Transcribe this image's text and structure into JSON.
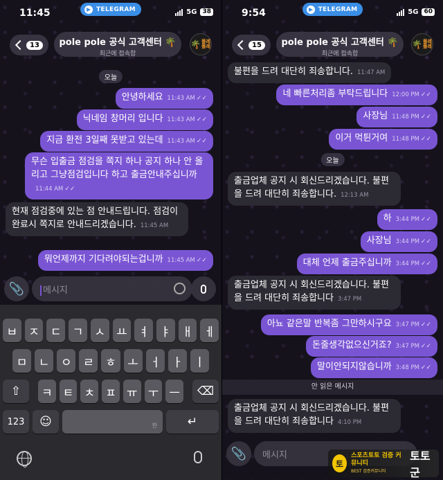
{
  "left": {
    "status": {
      "time": "11:45",
      "app": "TELEGRAM",
      "network": "5G",
      "battery": "38"
    },
    "header": {
      "unread": "13",
      "title": "pole pole 공식 고객센터 🌴",
      "subtitle": "최근에 접속함",
      "avatar_text": "폴레폴레"
    },
    "date_separator": "오늘",
    "messages": [
      {
        "dir": "out",
        "text": "안녕하세요",
        "time": "11:43 AM"
      },
      {
        "dir": "out",
        "text": "닉네임 창머리 입니다",
        "time": "11:43 AM"
      },
      {
        "dir": "out",
        "text": "지금 환전 3일째 못받고 있는데",
        "time": "11:43 AM"
      },
      {
        "dir": "out",
        "text": "무슨 입출금 점검을 쪽지 하나 공지 하나 안 올리고  그냥점검입니다 하고 출금안내주십니까",
        "time": "11:44 AM"
      },
      {
        "dir": "in",
        "text": "현재 점검중에 있는 점 안내드립니다. 점검이 완료시 쪽지로 안내드리겠습니다.",
        "time": "11:45 AM"
      },
      {
        "dir": "out",
        "text": "뭐언제까지 기다려야되는겁니까",
        "time": "11:45 AM"
      }
    ],
    "input_placeholder": "메시지",
    "keyboard": {
      "row1": [
        "ㅂ",
        "ㅈ",
        "ㄷ",
        "ㄱ",
        "ㅅ",
        "ㅛ",
        "ㅕ",
        "ㅑ",
        "ㅐ",
        "ㅔ"
      ],
      "row2": [
        "ㅁ",
        "ㄴ",
        "ㅇ",
        "ㄹ",
        "ㅎ",
        "ㅗ",
        "ㅓ",
        "ㅏ",
        "ㅣ"
      ],
      "row3": [
        "ㅋ",
        "ㅌ",
        "ㅊ",
        "ㅍ",
        "ㅠ",
        "ㅜ",
        "ㅡ"
      ],
      "num_key": "123",
      "space_label": "한",
      "shift_glyph": "⇧",
      "delete_glyph": "⌫",
      "return_glyph": "↵",
      "emoji_glyph": "☺"
    }
  },
  "right": {
    "status": {
      "time": "9:54",
      "app": "TELEGRAM",
      "network": "5G",
      "battery": "60"
    },
    "header": {
      "unread": "15",
      "title": "pole pole 공식 고객센터 🌴",
      "subtitle": "최근에 접속함",
      "avatar_text": "폴레폴레"
    },
    "messages_top": [
      {
        "dir": "in",
        "text": "불편을 드려 대단히 죄송합니다.",
        "time": "11:47 AM"
      },
      {
        "dir": "out",
        "text": "네 빠른처리좀 부탁드립니다",
        "time": "12:00 PM"
      },
      {
        "dir": "out",
        "text": "사장님",
        "time": "11:48 PM"
      },
      {
        "dir": "out",
        "text": "이거 먹튄거여",
        "time": "11:48 PM"
      }
    ],
    "date_separator": "오늘",
    "messages_mid": [
      {
        "dir": "in",
        "text": "출금업체 공지 시 회신드리겠습니다. 불편을 드려 대단히 죄송합니다.",
        "time": "12:13 AM"
      },
      {
        "dir": "out",
        "text": "하",
        "time": "3:44 PM"
      },
      {
        "dir": "out",
        "text": "사장님",
        "time": "3:44 PM"
      },
      {
        "dir": "out",
        "text": "대체 언제 출금주십니까",
        "time": "3:44 PM"
      },
      {
        "dir": "in",
        "text": "출금업체 공지 시 회신드리겠습니다. 불편을 드려 대단히 죄송합니다",
        "time": "3:47 PM"
      },
      {
        "dir": "out",
        "text": "아뇨 같은말 반복좀 그만하시구요",
        "time": "3:47 PM"
      },
      {
        "dir": "out",
        "text": "돈줄생각없으신거죠?",
        "time": "3:47 PM"
      },
      {
        "dir": "out",
        "text": "말이안되지않습니까",
        "time": "3:48 PM"
      }
    ],
    "unread_divider": "안 읽은 메시지",
    "messages_bottom": [
      {
        "dir": "in",
        "text": "출금업체 공지 시 회신드리겠습니다. 불편을 드려 대단히 죄송합니다",
        "time": "4:10 PM"
      }
    ],
    "input_placeholder": "메시지",
    "watermark": {
      "line1": "스포츠토토 검증 커뮤니티",
      "line2": "BEST 검증커뮤니티",
      "brand": "토토군",
      "logo": "토"
    }
  }
}
